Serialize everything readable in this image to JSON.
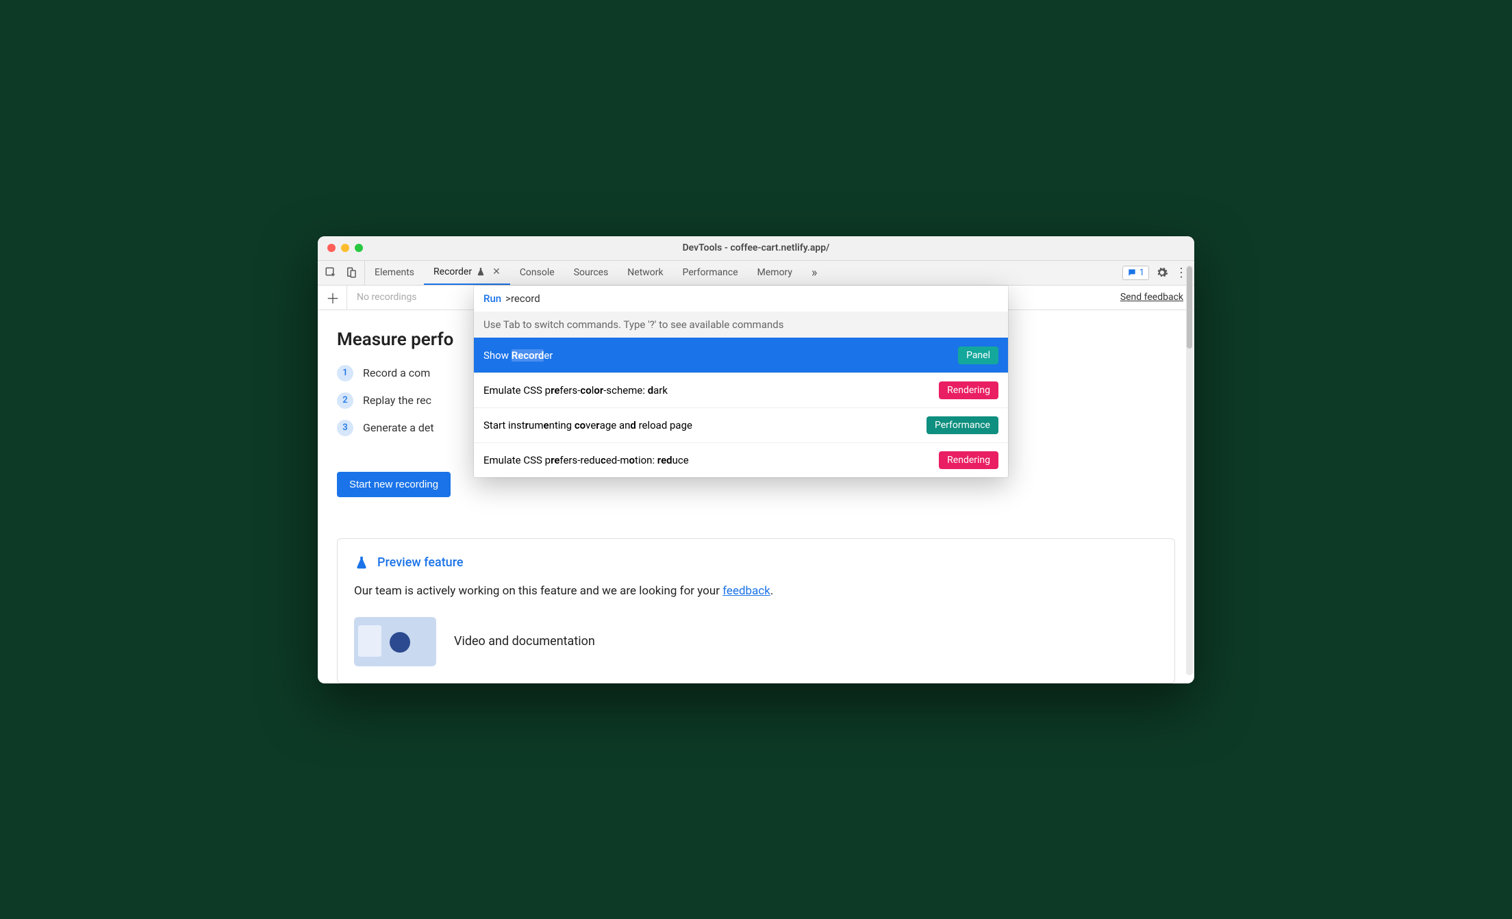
{
  "window": {
    "title": "DevTools - coffee-cart.netlify.app/"
  },
  "toolbar": {
    "tabs": [
      {
        "label": "Elements"
      },
      {
        "label": "Recorder"
      },
      {
        "label": "Console"
      },
      {
        "label": "Sources"
      },
      {
        "label": "Network"
      },
      {
        "label": "Performance"
      },
      {
        "label": "Memory"
      }
    ],
    "messages_count": "1"
  },
  "subbar": {
    "recordings_placeholder": "No recordings",
    "send_feedback": "Send feedback"
  },
  "main": {
    "title_partial": "Measure perfo",
    "steps_partial": [
      "Record a com",
      "Replay the rec",
      "Generate a det"
    ],
    "start_button": "Start new recording"
  },
  "preview": {
    "heading": "Preview feature",
    "text_prefix": "Our team is actively working on this feature and we are looking for your ",
    "feedback_link": "feedback",
    "text_suffix": ".",
    "doc_title": "Video and documentation"
  },
  "command_menu": {
    "run_label": "Run",
    "query": ">record",
    "hint": "Use Tab to switch commands. Type '?' to see available commands",
    "items": [
      {
        "text": "Show Recorder",
        "badge": "Panel",
        "badge_kind": "panel",
        "selected": true
      },
      {
        "text": "Emulate CSS prefers-color-scheme: dark",
        "badge": "Rendering",
        "badge_kind": "rendering",
        "selected": false
      },
      {
        "text": "Start instrumenting coverage and reload page",
        "badge": "Performance",
        "badge_kind": "performance",
        "selected": false
      },
      {
        "text": "Emulate CSS prefers-reduced-motion: reduce",
        "badge": "Rendering",
        "badge_kind": "rendering",
        "selected": false
      }
    ]
  }
}
